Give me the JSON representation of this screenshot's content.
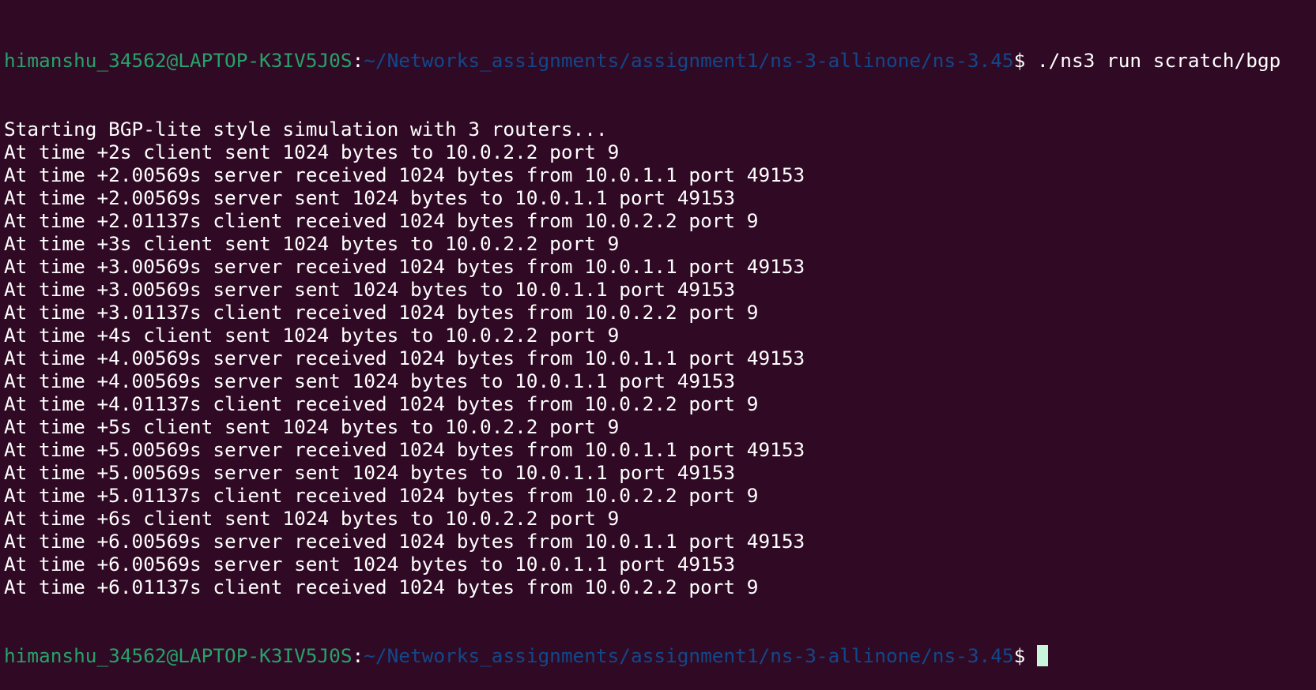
{
  "prompt": {
    "user_host": "himanshu_34562@LAPTOP-K3IV5J0S",
    "colon": ":",
    "path": "~/Networks_assignments/assignment1/ns-3-allinone/ns-3.45",
    "dollar": "$ ",
    "command": "./ns3 run scratch/bgp"
  },
  "output_lines": [
    "Starting BGP-lite style simulation with 3 routers...",
    "At time +2s client sent 1024 bytes to 10.0.2.2 port 9",
    "At time +2.00569s server received 1024 bytes from 10.0.1.1 port 49153",
    "At time +2.00569s server sent 1024 bytes to 10.0.1.1 port 49153",
    "At time +2.01137s client received 1024 bytes from 10.0.2.2 port 9",
    "At time +3s client sent 1024 bytes to 10.0.2.2 port 9",
    "At time +3.00569s server received 1024 bytes from 10.0.1.1 port 49153",
    "At time +3.00569s server sent 1024 bytes to 10.0.1.1 port 49153",
    "At time +3.01137s client received 1024 bytes from 10.0.2.2 port 9",
    "At time +4s client sent 1024 bytes to 10.0.2.2 port 9",
    "At time +4.00569s server received 1024 bytes from 10.0.1.1 port 49153",
    "At time +4.00569s server sent 1024 bytes to 10.0.1.1 port 49153",
    "At time +4.01137s client received 1024 bytes from 10.0.2.2 port 9",
    "At time +5s client sent 1024 bytes to 10.0.2.2 port 9",
    "At time +5.00569s server received 1024 bytes from 10.0.1.1 port 49153",
    "At time +5.00569s server sent 1024 bytes to 10.0.1.1 port 49153",
    "At time +5.01137s client received 1024 bytes from 10.0.2.2 port 9",
    "At time +6s client sent 1024 bytes to 10.0.2.2 port 9",
    "At time +6.00569s server received 1024 bytes from 10.0.1.1 port 49153",
    "At time +6.00569s server sent 1024 bytes to 10.0.1.1 port 49153",
    "At time +6.01137s client received 1024 bytes from 10.0.2.2 port 9"
  ],
  "final_prompt": {
    "user_host": "himanshu_34562@LAPTOP-K3IV5J0S",
    "colon": ":",
    "path": "~/Networks_assignments/assignment1/ns-3-allinone/ns-3.45",
    "dollar": "$ "
  },
  "colors": {
    "background": "#300a24",
    "user_host": "#26a269",
    "path": "#12488b",
    "text": "#ffffff",
    "cursor": "#c8f5dc"
  }
}
